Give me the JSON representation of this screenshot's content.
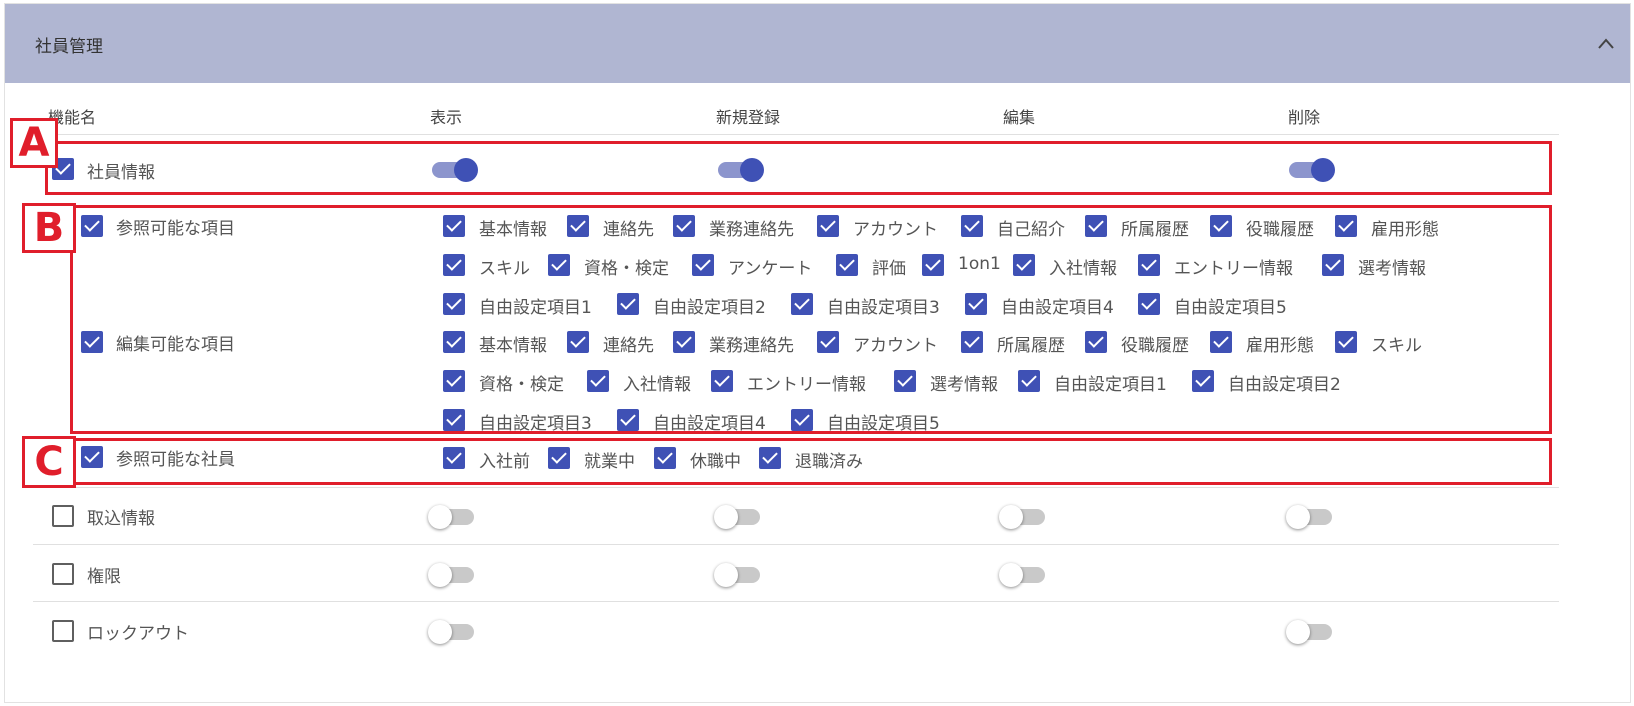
{
  "section": {
    "title": "社員管理"
  },
  "columns": {
    "name": "機能名",
    "view": "表示",
    "create": "新規登録",
    "edit": "編集",
    "delete": "削除"
  },
  "annotations": {
    "a": "A",
    "b": "B",
    "c": "C"
  },
  "rows": {
    "employee_info": {
      "label": "社員情報",
      "checked": true,
      "view": true,
      "create": true,
      "delete": true
    },
    "import_info": {
      "label": "取込情報",
      "checked": false,
      "view": false,
      "create": false,
      "edit": false,
      "delete": false
    },
    "permissions": {
      "label": "権限",
      "checked": false,
      "view": false,
      "create": false,
      "edit": false
    },
    "lockout": {
      "label": "ロックアウト",
      "checked": false,
      "view": false,
      "delete": false
    }
  },
  "viewable_items": {
    "label": "参照可能な項目",
    "items": [
      "基本情報",
      "連絡先",
      "業務連絡先",
      "アカウント",
      "自己紹介",
      "所属履歴",
      "役職履歴",
      "雇用形態",
      "スキル",
      "資格・検定",
      "アンケート",
      "評価",
      "1on1",
      "入社情報",
      "エントリー情報",
      "選考情報",
      "自由設定項目1",
      "自由設定項目2",
      "自由設定項目3",
      "自由設定項目4",
      "自由設定項目5"
    ]
  },
  "editable_items": {
    "label": "編集可能な項目",
    "items": [
      "基本情報",
      "連絡先",
      "業務連絡先",
      "アカウント",
      "所属履歴",
      "役職履歴",
      "雇用形態",
      "スキル",
      "資格・検定",
      "入社情報",
      "エントリー情報",
      "選考情報",
      "自由設定項目1",
      "自由設定項目2",
      "自由設定項目3",
      "自由設定項目4",
      "自由設定項目5"
    ]
  },
  "viewable_employees": {
    "label": "参照可能な社員",
    "items": [
      "入社前",
      "就業中",
      "休職中",
      "退職済み"
    ]
  },
  "colors": {
    "header_bg": "#b0b6d2",
    "accent": "#3f51b5",
    "annotation": "#e01e2b"
  }
}
